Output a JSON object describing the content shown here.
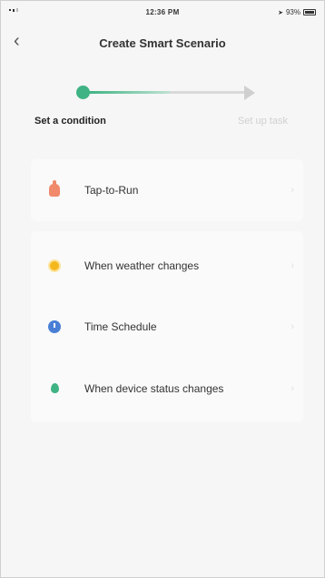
{
  "status_bar": {
    "time": "12:36 PM",
    "battery_text": "93%"
  },
  "header": {
    "title": "Create Smart Scenario",
    "back_icon": "chevron-left-icon"
  },
  "stepper": {
    "steps": [
      {
        "label": "Set a condition",
        "state": "active"
      },
      {
        "label": "Set up task",
        "state": "inactive"
      }
    ],
    "accent_color": "#3fb383"
  },
  "conditions": {
    "primary": [
      {
        "label": "Tap-to-Run",
        "icon": "hand-tap-icon",
        "icon_color": "#f08a6a"
      }
    ],
    "secondary": [
      {
        "label": "When weather changes",
        "icon": "sun-icon",
        "icon_color": "#f5b81c"
      },
      {
        "label": "Time Schedule",
        "icon": "clock-icon",
        "icon_color": "#4a7fd6"
      },
      {
        "label": "When device status changes",
        "icon": "drop-icon",
        "icon_color": "#3fb383"
      }
    ]
  }
}
